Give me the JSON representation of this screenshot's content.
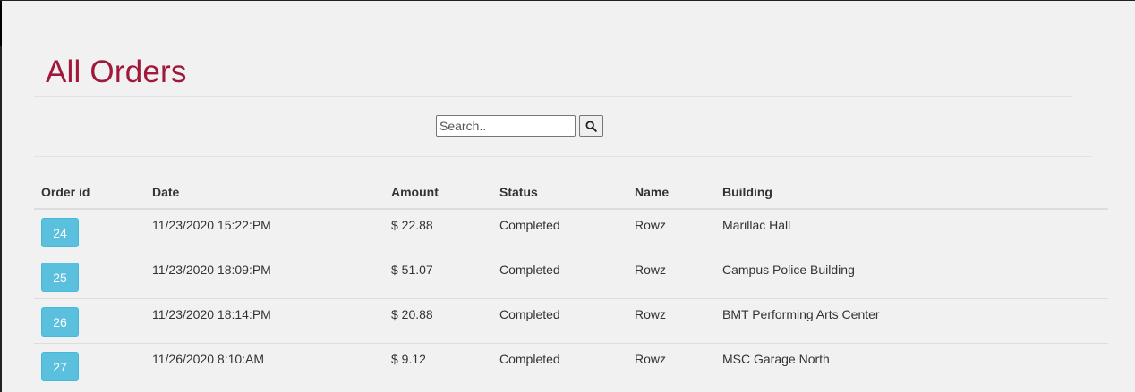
{
  "page": {
    "title": "All Orders"
  },
  "search": {
    "placeholder": "Search.."
  },
  "table": {
    "headers": {
      "order_id": "Order id",
      "date": "Date",
      "amount": "Amount",
      "status": "Status",
      "name": "Name",
      "building": "Building"
    },
    "rows": [
      {
        "order_id": "24",
        "date": "11/23/2020 15:22:PM",
        "amount": "$ 22.88",
        "status": "Completed",
        "name": "Rowz",
        "building": "Marillac Hall"
      },
      {
        "order_id": "25",
        "date": "11/23/2020 18:09:PM",
        "amount": "$ 51.07",
        "status": "Completed",
        "name": "Rowz",
        "building": "Campus Police Building"
      },
      {
        "order_id": "26",
        "date": "11/23/2020 18:14:PM",
        "amount": "$ 20.88",
        "status": "Completed",
        "name": "Rowz",
        "building": "BMT Performing Arts Center"
      },
      {
        "order_id": "27",
        "date": "11/26/2020 8:10:AM",
        "amount": "$ 9.12",
        "status": "Completed",
        "name": "Rowz",
        "building": "MSC Garage North"
      }
    ]
  },
  "colors": {
    "title": "#a0183a",
    "order_button": "#5bc0de",
    "background": "#f1f1f1"
  },
  "icons": {
    "search_button": "search-icon"
  }
}
